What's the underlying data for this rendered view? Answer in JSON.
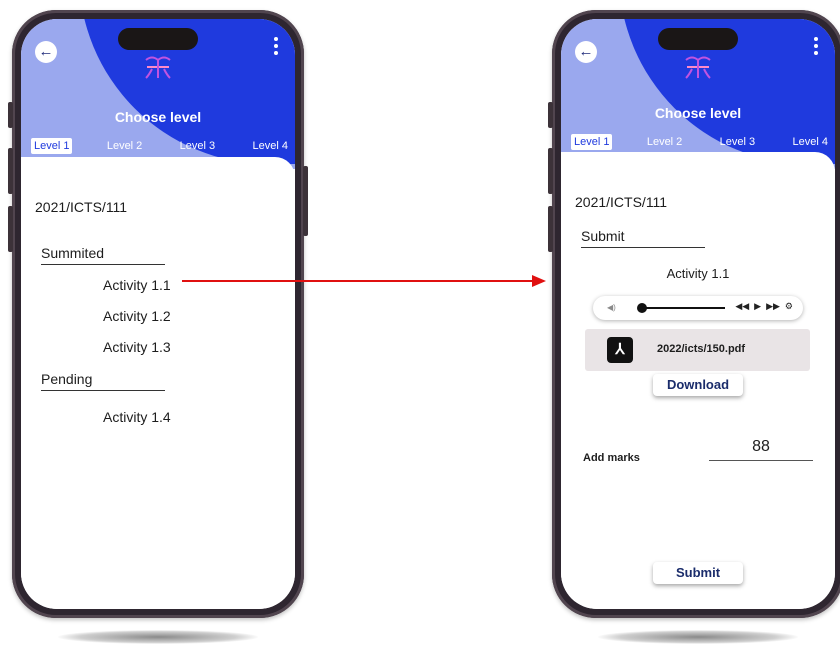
{
  "left_screen": {
    "header_title": "Choose level",
    "tabs": [
      "Level 1",
      "Level 2",
      "Level 3",
      "Level 4"
    ],
    "registration": "2021/ICTS/111",
    "submitted_label": "Summited",
    "submitted_items": [
      "Activity 1.1",
      "Activity 1.2",
      "Activity 1.3"
    ],
    "pending_label": "Pending",
    "pending_items": [
      "Activity 1.4"
    ]
  },
  "right_screen": {
    "header_title": "Choose level",
    "tabs": [
      "Level 1",
      "Level 2",
      "Level 3",
      "Level 4"
    ],
    "registration": "2021/ICTS/111",
    "section_label": "Submit",
    "activity_title": "Activity 1.1",
    "file_name": "2022/icts/150.pdf",
    "download_label": "Download",
    "marks_label": "Add marks",
    "marks_value": "88",
    "submit_label": "Submit"
  },
  "colors": {
    "header_blue": "#1f3ade",
    "header_light": "#9aa8ee",
    "arrow_red": "#e01010",
    "button_text": "#1a2c6b"
  }
}
